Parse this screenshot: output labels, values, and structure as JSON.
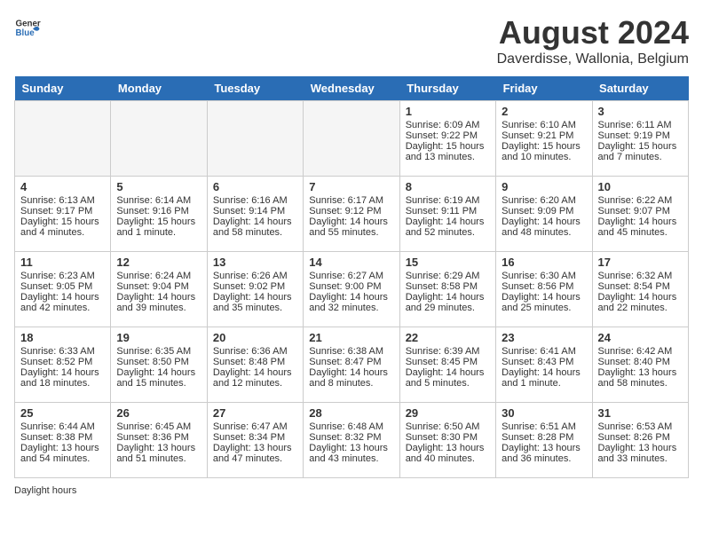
{
  "header": {
    "logo_general": "General",
    "logo_blue": "Blue",
    "month_title": "August 2024",
    "location": "Daverdisse, Wallonia, Belgium"
  },
  "days_of_week": [
    "Sunday",
    "Monday",
    "Tuesday",
    "Wednesday",
    "Thursday",
    "Friday",
    "Saturday"
  ],
  "weeks": [
    [
      {
        "day": "",
        "empty": true
      },
      {
        "day": "",
        "empty": true
      },
      {
        "day": "",
        "empty": true
      },
      {
        "day": "",
        "empty": true
      },
      {
        "day": "1",
        "sunrise": "6:09 AM",
        "sunset": "9:22 PM",
        "daylight": "15 hours and 13 minutes."
      },
      {
        "day": "2",
        "sunrise": "6:10 AM",
        "sunset": "9:21 PM",
        "daylight": "15 hours and 10 minutes."
      },
      {
        "day": "3",
        "sunrise": "6:11 AM",
        "sunset": "9:19 PM",
        "daylight": "15 hours and 7 minutes."
      }
    ],
    [
      {
        "day": "4",
        "sunrise": "6:13 AM",
        "sunset": "9:17 PM",
        "daylight": "15 hours and 4 minutes."
      },
      {
        "day": "5",
        "sunrise": "6:14 AM",
        "sunset": "9:16 PM",
        "daylight": "15 hours and 1 minute."
      },
      {
        "day": "6",
        "sunrise": "6:16 AM",
        "sunset": "9:14 PM",
        "daylight": "14 hours and 58 minutes."
      },
      {
        "day": "7",
        "sunrise": "6:17 AM",
        "sunset": "9:12 PM",
        "daylight": "14 hours and 55 minutes."
      },
      {
        "day": "8",
        "sunrise": "6:19 AM",
        "sunset": "9:11 PM",
        "daylight": "14 hours and 52 minutes."
      },
      {
        "day": "9",
        "sunrise": "6:20 AM",
        "sunset": "9:09 PM",
        "daylight": "14 hours and 48 minutes."
      },
      {
        "day": "10",
        "sunrise": "6:22 AM",
        "sunset": "9:07 PM",
        "daylight": "14 hours and 45 minutes."
      }
    ],
    [
      {
        "day": "11",
        "sunrise": "6:23 AM",
        "sunset": "9:05 PM",
        "daylight": "14 hours and 42 minutes."
      },
      {
        "day": "12",
        "sunrise": "6:24 AM",
        "sunset": "9:04 PM",
        "daylight": "14 hours and 39 minutes."
      },
      {
        "day": "13",
        "sunrise": "6:26 AM",
        "sunset": "9:02 PM",
        "daylight": "14 hours and 35 minutes."
      },
      {
        "day": "14",
        "sunrise": "6:27 AM",
        "sunset": "9:00 PM",
        "daylight": "14 hours and 32 minutes."
      },
      {
        "day": "15",
        "sunrise": "6:29 AM",
        "sunset": "8:58 PM",
        "daylight": "14 hours and 29 minutes."
      },
      {
        "day": "16",
        "sunrise": "6:30 AM",
        "sunset": "8:56 PM",
        "daylight": "14 hours and 25 minutes."
      },
      {
        "day": "17",
        "sunrise": "6:32 AM",
        "sunset": "8:54 PM",
        "daylight": "14 hours and 22 minutes."
      }
    ],
    [
      {
        "day": "18",
        "sunrise": "6:33 AM",
        "sunset": "8:52 PM",
        "daylight": "14 hours and 18 minutes."
      },
      {
        "day": "19",
        "sunrise": "6:35 AM",
        "sunset": "8:50 PM",
        "daylight": "14 hours and 15 minutes."
      },
      {
        "day": "20",
        "sunrise": "6:36 AM",
        "sunset": "8:48 PM",
        "daylight": "14 hours and 12 minutes."
      },
      {
        "day": "21",
        "sunrise": "6:38 AM",
        "sunset": "8:47 PM",
        "daylight": "14 hours and 8 minutes."
      },
      {
        "day": "22",
        "sunrise": "6:39 AM",
        "sunset": "8:45 PM",
        "daylight": "14 hours and 5 minutes."
      },
      {
        "day": "23",
        "sunrise": "6:41 AM",
        "sunset": "8:43 PM",
        "daylight": "14 hours and 1 minute."
      },
      {
        "day": "24",
        "sunrise": "6:42 AM",
        "sunset": "8:40 PM",
        "daylight": "13 hours and 58 minutes."
      }
    ],
    [
      {
        "day": "25",
        "sunrise": "6:44 AM",
        "sunset": "8:38 PM",
        "daylight": "13 hours and 54 minutes."
      },
      {
        "day": "26",
        "sunrise": "6:45 AM",
        "sunset": "8:36 PM",
        "daylight": "13 hours and 51 minutes."
      },
      {
        "day": "27",
        "sunrise": "6:47 AM",
        "sunset": "8:34 PM",
        "daylight": "13 hours and 47 minutes."
      },
      {
        "day": "28",
        "sunrise": "6:48 AM",
        "sunset": "8:32 PM",
        "daylight": "13 hours and 43 minutes."
      },
      {
        "day": "29",
        "sunrise": "6:50 AM",
        "sunset": "8:30 PM",
        "daylight": "13 hours and 40 minutes."
      },
      {
        "day": "30",
        "sunrise": "6:51 AM",
        "sunset": "8:28 PM",
        "daylight": "13 hours and 36 minutes."
      },
      {
        "day": "31",
        "sunrise": "6:53 AM",
        "sunset": "8:26 PM",
        "daylight": "13 hours and 33 minutes."
      }
    ]
  ],
  "footer_note": "Daylight hours"
}
